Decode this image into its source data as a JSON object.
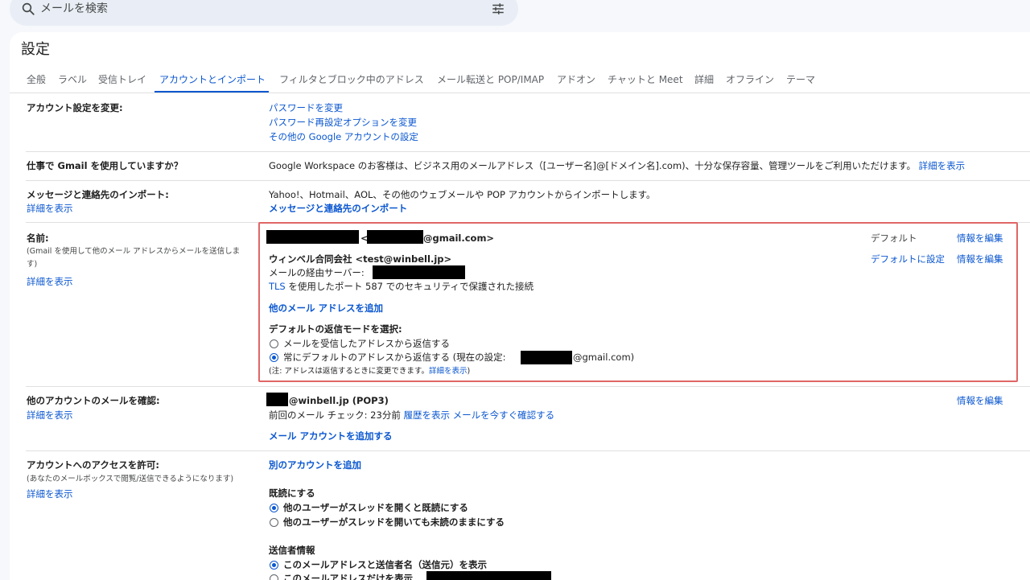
{
  "search": {
    "placeholder": "メールを検索",
    "search_icon": "search-icon",
    "tune_icon": "tune-icon"
  },
  "page": {
    "title": "設定"
  },
  "tabs": [
    {
      "label": "全般"
    },
    {
      "label": "ラベル"
    },
    {
      "label": "受信トレイ"
    },
    {
      "label": "アカウントとインポート",
      "active": true
    },
    {
      "label": "フィルタとブロック中のアドレス"
    },
    {
      "label": "メール転送と POP/IMAP"
    },
    {
      "label": "アドオン"
    },
    {
      "label": "チャットと Meet"
    },
    {
      "label": "詳細"
    },
    {
      "label": "オフライン"
    },
    {
      "label": "テーマ"
    }
  ],
  "colors": {
    "accent": "#0b57d0",
    "highlight_border": "#e06666",
    "tab_active": "#0b57d0"
  },
  "sections": {
    "change_account": {
      "label": "アカウント設定を変更:",
      "links": [
        "パスワードを変更",
        "パスワード再設定オプションを変更",
        "その他の Google アカウントの設定"
      ]
    },
    "workspace": {
      "label": "仕事で Gmail を使用していますか？",
      "text": "Google Workspace のお客様は、ビジネス用のメールアドレス（[ユーザー名]@[ドメイン名].com)、十分な保存容量、管理ツールをご利用いただけます。",
      "link": "詳細を表示"
    },
    "import": {
      "label": "メッセージと連絡先のインポート:",
      "detail_link": "詳細を表示",
      "text": "Yahoo!、Hotmail、AOL、その他のウェブメールや POP アカウントからインポートします。",
      "action_link": "メッセージと連絡先のインポート"
    },
    "name": {
      "label": "名前:",
      "note": "(Gmail を使用して他のメール アドレスからメールを送信しま",
      "note2": "す)",
      "detail_link": "詳細を表示",
      "account1": {
        "lt": "<",
        "email_suffix": "@gmail.com>",
        "status": "デフォルト",
        "edit": "情報を編集"
      },
      "account2": {
        "name": "ウィンベル合同会社 <test@winbell.jp>",
        "server_label": "メールの経由サーバー:",
        "tls_link": "TLS",
        "tls_text": " を使用したポート 587 でのセキュリティで保護された接続",
        "set_default": "デフォルトに設定",
        "edit": "情報を編集"
      },
      "add_address": "他のメール アドレスを追加",
      "reply_mode_title": "デフォルトの返信モードを選択:",
      "reply_option1": "メールを受信したアドレスから返信する",
      "reply_option2_prefix": "常にデフォルトのアドレスから返信する (現在の設定:",
      "reply_option2_suffix": "@gmail.com)",
      "note_prefix": "(注: アドレスは返信するときに変更できます。",
      "note_link": "詳細を表示",
      "note_suffix": ")"
    },
    "check_mail": {
      "label": "他のアカウントのメールを確認:",
      "detail_link": "詳細を表示",
      "account": "@winbell.jp (POP3)",
      "last_check": "前回のメール チェック: 23分前",
      "history_link": "履歴を表示",
      "check_now_link": "メールを今すぐ確認する",
      "edit": "情報を編集",
      "add_account": "メール アカウントを追加する"
    },
    "grant_access": {
      "label": "アカウントへのアクセスを許可:",
      "note": "(あなたのメールボックスで閲覧/送信できるようになります)",
      "detail_link": "詳細を表示",
      "add_link": "別のアカウントを追加",
      "mark_read_title": "既読にする",
      "mark_read_option1": "他のユーザーがスレッドを開くと既読にする",
      "mark_read_option2": "他のユーザーがスレッドを開いても未読のままにする",
      "sender_info_title": "送信者情報",
      "sender_option1": "このメールアドレスと送信者名（送信元）を表示",
      "sender_option2": "このメールアドレスだけを表示"
    }
  }
}
